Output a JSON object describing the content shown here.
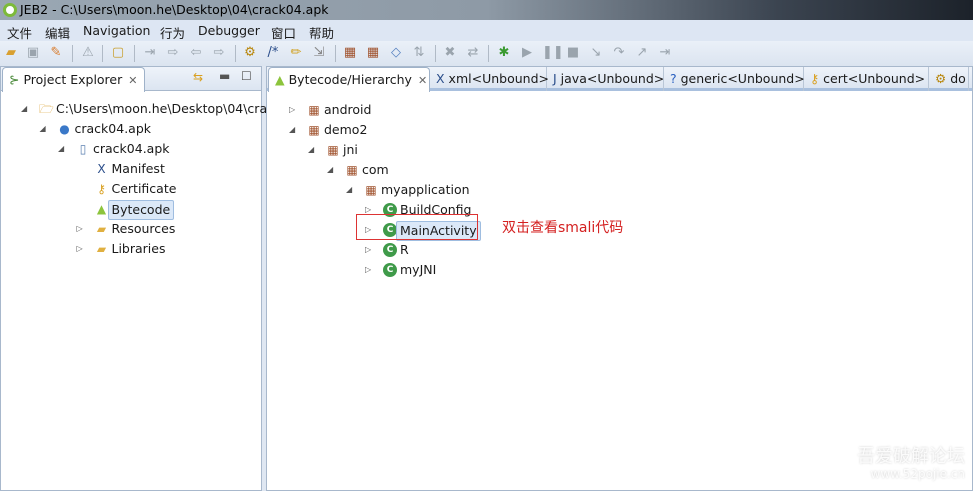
{
  "window": {
    "title": "JEB2 - C:\\Users\\moon.he\\Desktop\\04\\crack04.apk"
  },
  "menu": [
    "文件",
    "编辑",
    "Navigation",
    "行为",
    "Debugger",
    "窗口",
    "帮助"
  ],
  "left_panel": {
    "tab": "Project Explorer",
    "tree": [
      {
        "label": "C:\\Users\\moon.he\\Desktop\\04\\cra",
        "depth": 0,
        "state": "open",
        "icon": "folder-open-icon"
      },
      {
        "label": "crack04.apk",
        "depth": 1,
        "state": "open",
        "icon": "blue-dot-icon"
      },
      {
        "label": "crack04.apk",
        "depth": 2,
        "state": "open",
        "icon": "apk-icon"
      },
      {
        "label": "Manifest",
        "depth": 3,
        "state": "leaf",
        "icon": "xml-icon"
      },
      {
        "label": "Certificate",
        "depth": 3,
        "state": "leaf",
        "icon": "key-icon"
      },
      {
        "label": "Bytecode",
        "depth": 3,
        "state": "leaf",
        "icon": "android-icon",
        "selected": true
      },
      {
        "label": "Resources",
        "depth": 3,
        "state": "closed",
        "icon": "folder-icon"
      },
      {
        "label": "Libraries",
        "depth": 3,
        "state": "closed",
        "icon": "folder-icon"
      }
    ]
  },
  "right_panel": {
    "tabs": [
      {
        "label": "Bytecode/Hierarchy",
        "icon": "android-icon",
        "active": true
      },
      {
        "label": "xml<Unbound>",
        "icon": "xml-icon"
      },
      {
        "label": "java<Unbound>",
        "icon": "java-icon"
      },
      {
        "label": "generic<Unbound>",
        "icon": "question-icon"
      },
      {
        "label": "cert<Unbound>",
        "icon": "key-icon"
      },
      {
        "label": "do",
        "icon": "gears-icon"
      }
    ],
    "tree": [
      {
        "label": "android",
        "depth": 0,
        "state": "closed",
        "type": "package"
      },
      {
        "label": "demo2",
        "depth": 0,
        "state": "open",
        "type": "package"
      },
      {
        "label": "jni",
        "depth": 1,
        "state": "open",
        "type": "package"
      },
      {
        "label": "com",
        "depth": 2,
        "state": "open",
        "type": "package"
      },
      {
        "label": "myapplication",
        "depth": 3,
        "state": "open",
        "type": "package"
      },
      {
        "label": "BuildConfig",
        "depth": 4,
        "state": "closed",
        "type": "class"
      },
      {
        "label": "MainActivity",
        "depth": 4,
        "state": "closed",
        "type": "class",
        "selected": true
      },
      {
        "label": "R",
        "depth": 4,
        "state": "closed",
        "type": "class"
      },
      {
        "label": "myJNI",
        "depth": 4,
        "state": "closed",
        "type": "class"
      }
    ]
  },
  "annotation": "双击查看smali代码",
  "watermark": {
    "line1": "吾爱破解论坛",
    "line2": "www.52pojie.cn"
  },
  "colors": {
    "annotation": "#d42020",
    "class_icon": "#3f9a49"
  }
}
